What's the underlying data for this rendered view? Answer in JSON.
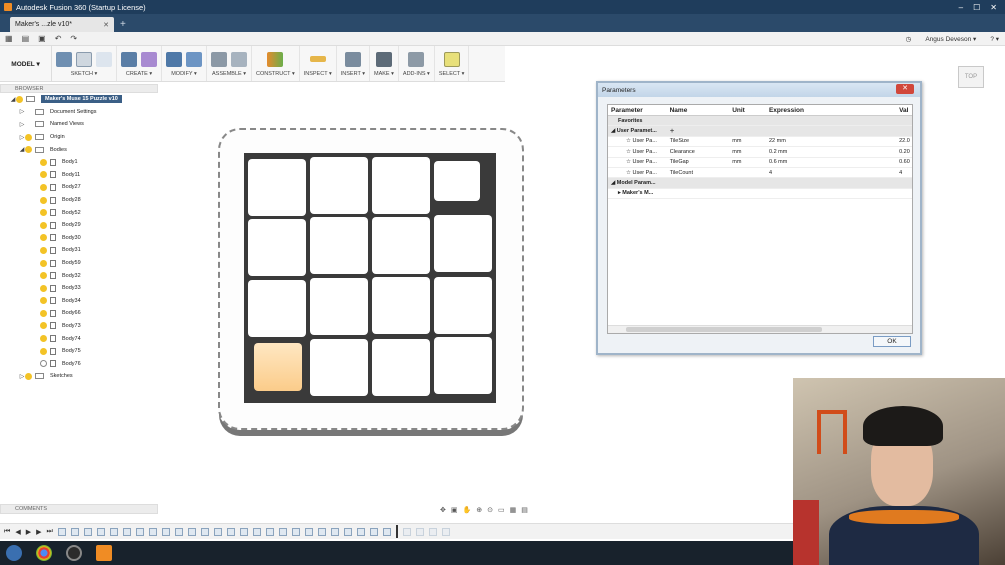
{
  "window": {
    "title": "Autodesk Fusion 360 (Startup License)",
    "controls": [
      "–",
      "☐",
      "✕"
    ]
  },
  "tabs": {
    "doc_tab_label": "Maker's ...zle v10*",
    "close": "✕",
    "new": "+"
  },
  "quickbar": {
    "user_name": "Angus Deveson ▾",
    "help": "? ▾"
  },
  "toolbar": {
    "workspace": "MODEL ▾",
    "groups": [
      {
        "label": "SKETCH ▾"
      },
      {
        "label": "CREATE ▾"
      },
      {
        "label": "MODIFY ▾"
      },
      {
        "label": "ASSEMBLE ▾"
      },
      {
        "label": "CONSTRUCT ▾"
      },
      {
        "label": "INSPECT ▾"
      },
      {
        "label": "INSERT ▾"
      },
      {
        "label": "MAKE ▾"
      },
      {
        "label": "ADD-INS ▾"
      },
      {
        "label": "SELECT ▾"
      }
    ]
  },
  "browser": {
    "title": "BROWSER",
    "root": "Maker's Muse 15 Puzzle v10",
    "items": [
      "Document Settings",
      "Named Views",
      "Origin",
      "Bodies"
    ],
    "bodies": [
      "Body1",
      "Body11",
      "Body27",
      "Body28",
      "Body52",
      "Body29",
      "Body30",
      "Body31",
      "Body59",
      "Body32",
      "Body33",
      "Body34",
      "Body66",
      "Body73",
      "Body74",
      "Body75",
      "Body76"
    ],
    "sketches": "Sketches"
  },
  "viewcube": {
    "label": "TOP"
  },
  "parameters_dialog": {
    "title": "Parameters",
    "close": "✕",
    "headers": {
      "parameter": "Parameter",
      "name": "Name",
      "unit": "Unit",
      "expression": "Expression",
      "value": "Val"
    },
    "group_favorites": "Favorites",
    "group_user": "User Paramet...",
    "rows": [
      {
        "param": "User Pa...",
        "name": "TileSize",
        "unit": "mm",
        "expression": "22 mm",
        "value": "22.0"
      },
      {
        "param": "User Pa...",
        "name": "Clearance",
        "unit": "mm",
        "expression": "0.2 mm",
        "value": "0.20"
      },
      {
        "param": "User Pa...",
        "name": "TileGap",
        "unit": "mm",
        "expression": "0.6 mm",
        "value": "0.60"
      },
      {
        "param": "User Pa...",
        "name": "TileCount",
        "unit": "",
        "expression": "4",
        "value": "4"
      }
    ],
    "group_model": "Model Param...",
    "model_child": "Maker's M...",
    "ok": "OK"
  },
  "comments": {
    "title": "COMMENTS"
  },
  "colors": {
    "title_bar": "#1f3d5c",
    "selected_row": "#3b5f86",
    "bulb": "#f3c326",
    "highlight_tile": "#fbcc8a"
  }
}
